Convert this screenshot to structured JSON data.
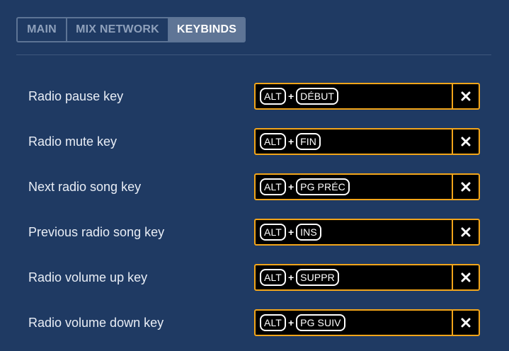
{
  "tabs": [
    {
      "label": "MAIN",
      "active": false
    },
    {
      "label": "MIX NETWORK",
      "active": false
    },
    {
      "label": "KEYBINDS",
      "active": true
    }
  ],
  "keybinds": [
    {
      "label": "Radio pause key",
      "modifier": "ALT",
      "plus": "+",
      "key": "DÉBUT"
    },
    {
      "label": "Radio mute key",
      "modifier": "ALT",
      "plus": "+",
      "key": "FIN"
    },
    {
      "label": "Next radio song key",
      "modifier": "ALT",
      "plus": "+",
      "key": "PG PRÉC"
    },
    {
      "label": "Previous radio song key",
      "modifier": "ALT",
      "plus": "+",
      "key": "INS"
    },
    {
      "label": "Radio volume up key",
      "modifier": "ALT",
      "plus": "+",
      "key": "SUPPR"
    },
    {
      "label": "Radio volume down key",
      "modifier": "ALT",
      "plus": "+",
      "key": "PG SUIV"
    }
  ],
  "icons": {
    "clear": "close-icon"
  },
  "colors": {
    "background": "#1f3a63",
    "tab_active": "#5f7596",
    "accent_border": "#f2a51a",
    "field_bg": "#000000"
  }
}
